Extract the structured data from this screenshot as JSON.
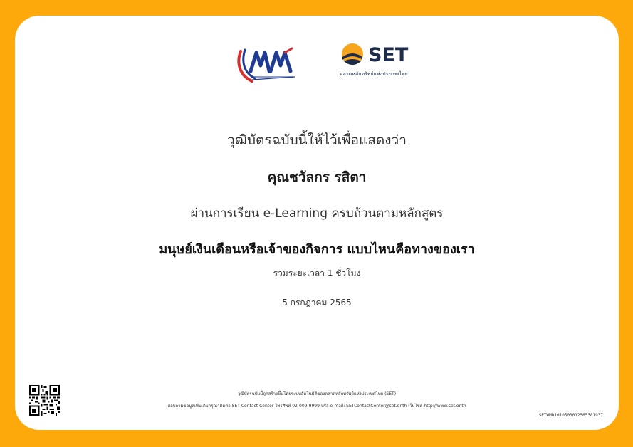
{
  "colors": {
    "border": "#FDA90C",
    "card": "#FFFFFF",
    "set_navy": "#1E2A4A",
    "set_orange": "#F7A51C",
    "kpk_blue": "#1F3A93",
    "kpk_red": "#D62D2D"
  },
  "logos": {
    "left_icon": "kpk-logo",
    "right_icon": "set-logo",
    "set_word": "SET",
    "set_subtitle": "ตลาดหลักทรัพย์แห่งประเทศไทย"
  },
  "certificate": {
    "intro": "วุฒิบัตรฉบับนี้ให้ไว้เพื่อแสดงว่า",
    "name": "คุณชวัลกร รสิตา",
    "passed": "ผ่านการเรียน e-Learning ครบถ้วนตามหลักสูตร",
    "course": "มนุษย์เงินเดือนหรือเจ้าของกิจการ แบบไหนคือทางของเรา",
    "duration": "รวมระยะเวลา 1 ชั่วโมง",
    "date": "5 กรกฎาคม 2565"
  },
  "footer": {
    "line1": "วุฒิบัตรฉบับนี้ถูกสร้างขึ้นโดยระบบอัตโนมัติของตลาดหลักทรัพย์แห่งประเทศไทย (SET)",
    "line2": "สอบถามข้อมูลเพิ่มเติมกรุณาติดต่อ SET Contact Center โทรศัพท์ 02-009-9999 หรือ e-mail: SETContactCenter@set.or.th เว็บไซต์ http://www.set.or.th",
    "cert_id": "SETWMD1010500012565381937",
    "qr_icon": "qr-code-icon"
  }
}
